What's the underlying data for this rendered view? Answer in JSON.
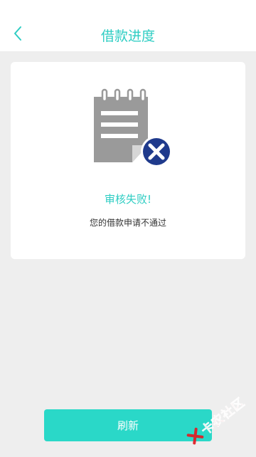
{
  "header": {
    "title": "借款进度",
    "back_icon": "chevron-left-icon"
  },
  "status": {
    "icon": "document-rejected-icon",
    "title": "审核失败!",
    "description": "您的借款申请不通过"
  },
  "actions": {
    "refresh_label": "刷新"
  },
  "watermark": {
    "text": "卡农社区"
  },
  "colors": {
    "accent": "#2ecdc3",
    "button": "#2ad8c8",
    "badge": "#1f3a8c",
    "icon_gray": "#9a9a9a",
    "background": "#eeeeee"
  }
}
